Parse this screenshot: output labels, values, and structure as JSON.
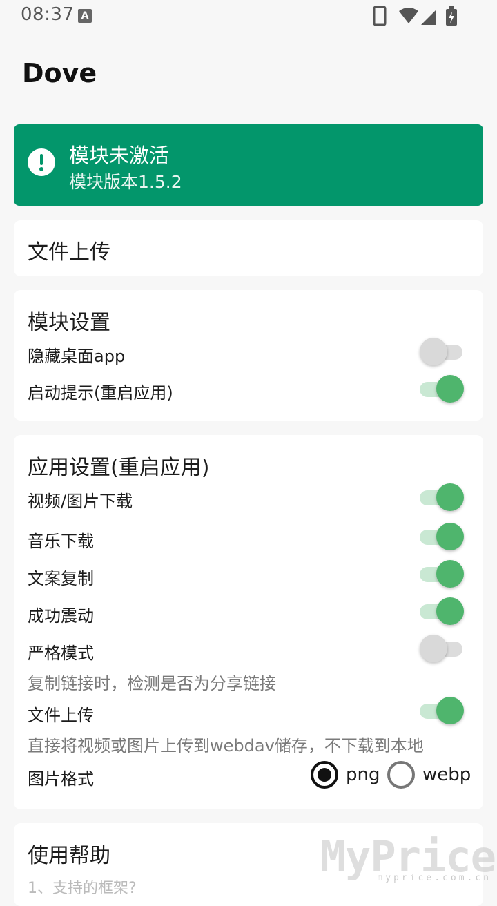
{
  "status_bar": {
    "time": "08:37",
    "notif_icon": "A"
  },
  "app": {
    "title": "Dove"
  },
  "module_status": {
    "title": "模块未激活",
    "version": "模块版本1.5.2",
    "color": "#03966b"
  },
  "upload_section": {
    "title": "文件上传"
  },
  "module_settings": {
    "title": "模块设置",
    "items": [
      {
        "label": "隐藏桌面app",
        "on": false
      },
      {
        "label": "启动提示(重启应用)",
        "on": true
      }
    ]
  },
  "app_settings": {
    "title": "应用设置(重启应用)",
    "items": [
      {
        "label": "视频/图片下载",
        "on": true
      },
      {
        "label": "音乐下载",
        "on": true
      },
      {
        "label": "文案复制",
        "on": true
      },
      {
        "label": "成功震动",
        "on": true
      },
      {
        "label": "严格模式",
        "on": false,
        "hint": "复制链接时，检测是否为分享链接"
      },
      {
        "label": "文件上传",
        "on": true,
        "hint": "直接将视频或图片上传到webdav储存，不下载到本地"
      }
    ],
    "image_format": {
      "label": "图片格式",
      "options": [
        "png",
        "webp"
      ],
      "selected": "png"
    }
  },
  "help": {
    "title": "使用帮助",
    "first_item": "1、支持的框架?"
  },
  "watermark": {
    "text": "MyPrice",
    "sub": "myprice.com.cn"
  },
  "accent_color": "#4fb56d"
}
